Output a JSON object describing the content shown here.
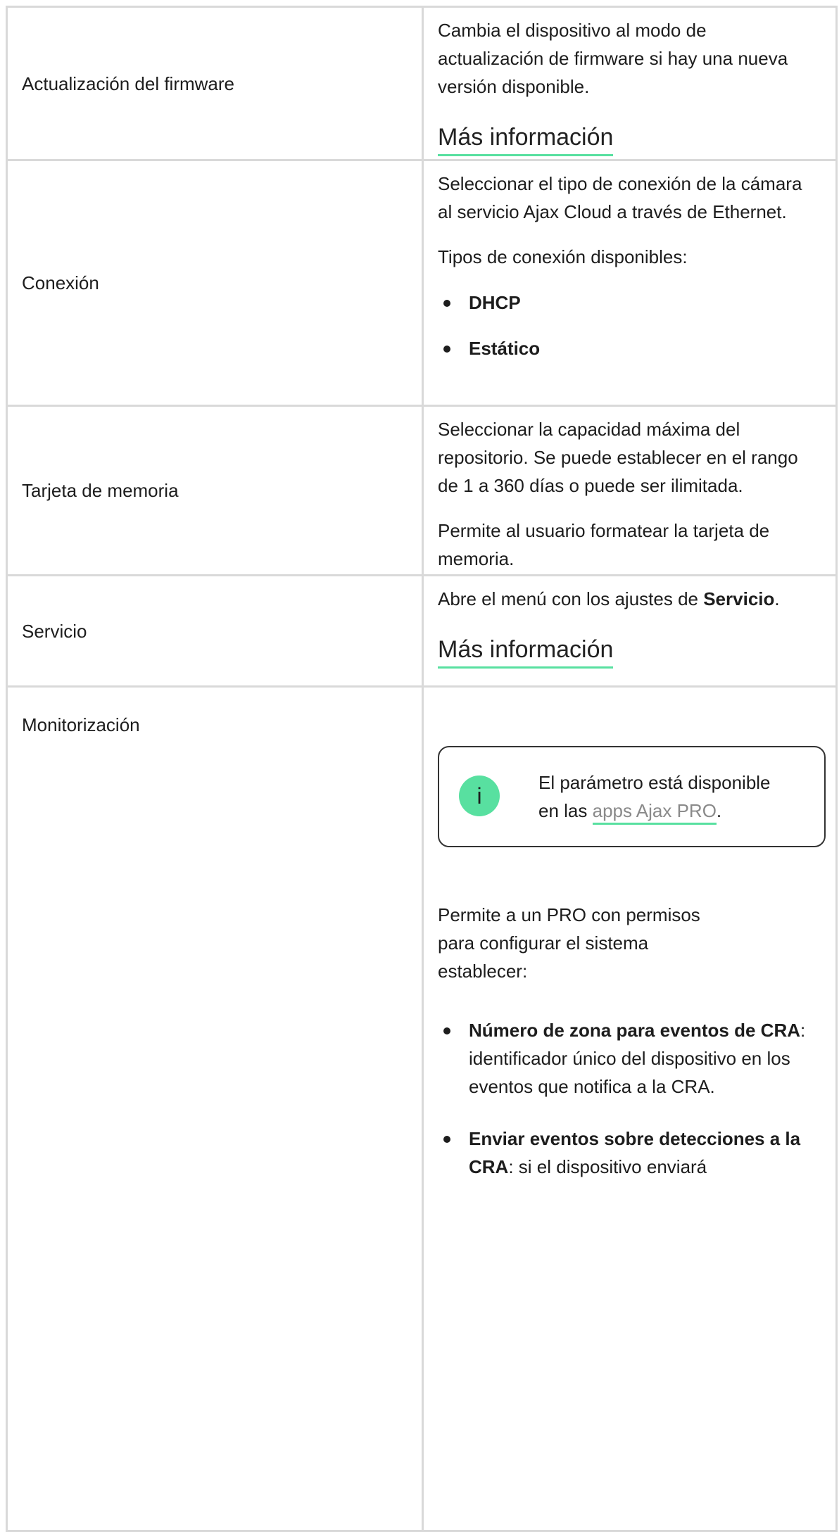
{
  "rows": [
    {
      "label": "Actualización del firmware",
      "desc": "Cambia el dispositivo al modo de actualización de firmware si hay una nueva versión disponible.",
      "link": "Más información"
    },
    {
      "label": "Conexión",
      "desc": "Seleccionar el tipo de conexión de la cámara al servicio Ajax Cloud a través de Ethernet.",
      "desc2": "Tipos de conexión disponibles:",
      "options": [
        "DHCP",
        "Estático"
      ]
    },
    {
      "label": "Tarjeta de memoria",
      "desc": "Seleccionar la capacidad máxima del repositorio. Se puede establecer en el rango de 1 a 360 días o puede ser ilimitada.",
      "desc2": "Permite al usuario formatear la tarjeta de memoria."
    },
    {
      "label": "Servicio",
      "desc_prefix": "Abre el menú con los ajustes de ",
      "desc_bold": "Servicio",
      "desc_suffix": ".",
      "link": "Más información"
    },
    {
      "label": "Monitorización",
      "note_prefix": "El parámetro está disponible en las ",
      "note_link": "apps Ajax PRO",
      "note_suffix": ".",
      "desc": "Permite a un PRO con permisos para configurar el sistema establecer:",
      "bullets": [
        {
          "bold": "Número de zona para eventos de CRA",
          "text": ": identificador único del dispositivo en los eventos que notifica a la CRA."
        },
        {
          "bold": "Enviar eventos sobre detecciones a la CRA",
          "text": ": si el dispositivo enviará"
        }
      ]
    }
  ],
  "colors": {
    "accent": "#58e0a0",
    "border": "#d9d9d9",
    "text": "#1d1d1d"
  },
  "icons": {
    "info": "info-icon"
  }
}
